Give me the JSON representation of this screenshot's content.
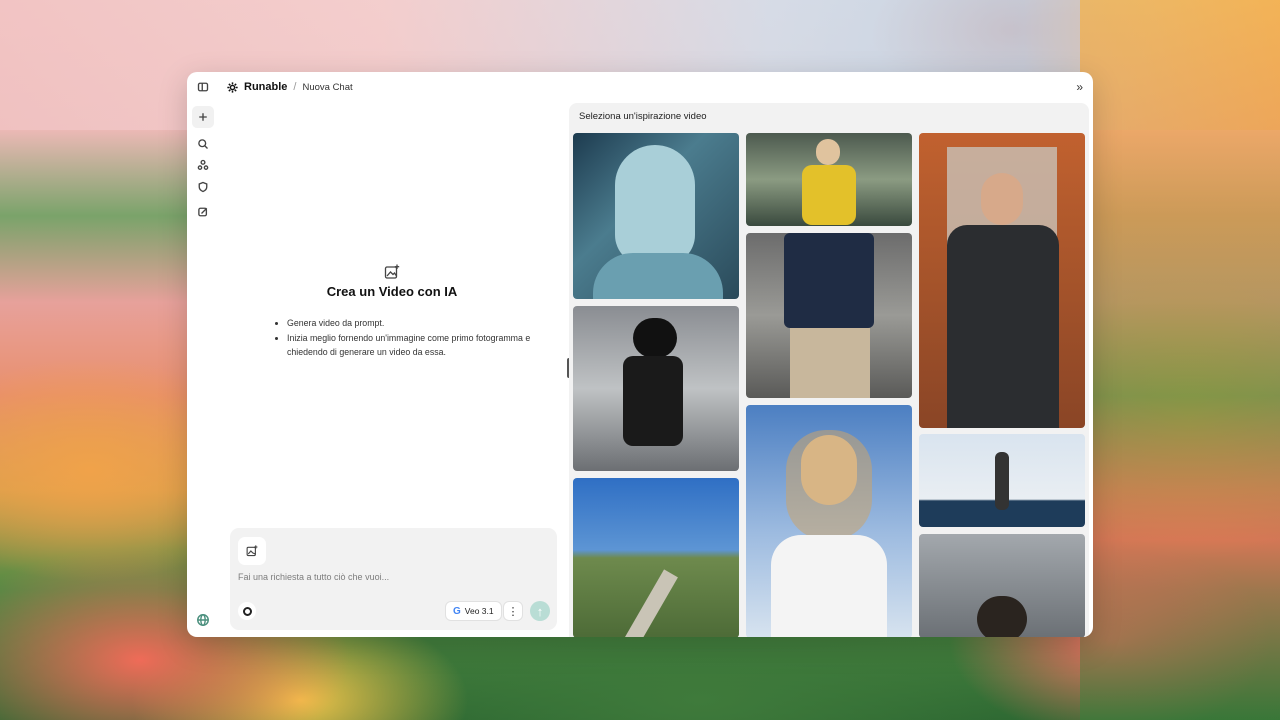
{
  "app": {
    "brand": "Runable",
    "breadcrumb": "Nuova Chat"
  },
  "rail": {
    "icons": [
      "sidebar-toggle-icon",
      "plus-icon",
      "search-icon",
      "people-icon",
      "shield-icon",
      "edit-icon",
      "globe-icon"
    ]
  },
  "empty_state": {
    "title": "Crea un Video con IA",
    "bullets": [
      "Genera video da prompt.",
      "Inizia meglio fornendo un'immagine come primo fotogramma e chiedendo di generare un video da essa."
    ]
  },
  "composer": {
    "placeholder": "Fai una richiesta a tutto ciò che vuoi...",
    "model_label": "Veo 3.1",
    "model_logo": "G"
  },
  "inspiration": {
    "title": "Seleziona un'ispirazione video"
  },
  "colors": {
    "accent_send": "#b9ddd5",
    "panel_bg": "#f2f2f2"
  }
}
